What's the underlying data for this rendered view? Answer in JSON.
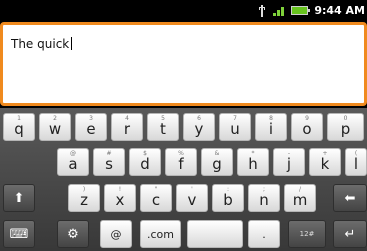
{
  "status_bar": {
    "time": "9:44 AM"
  },
  "text_field": {
    "value": "The quick"
  },
  "keyboard": {
    "row1": [
      {
        "label": "q",
        "sub": "1"
      },
      {
        "label": "w",
        "sub": "2"
      },
      {
        "label": "e",
        "sub": "3"
      },
      {
        "label": "r",
        "sub": "4"
      },
      {
        "label": "t",
        "sub": "5"
      },
      {
        "label": "y",
        "sub": "6"
      },
      {
        "label": "u",
        "sub": "7"
      },
      {
        "label": "i",
        "sub": "8"
      },
      {
        "label": "o",
        "sub": "9"
      },
      {
        "label": "p",
        "sub": "0"
      }
    ],
    "row2": [
      {
        "label": "a",
        "sub": "@"
      },
      {
        "label": "s",
        "sub": "#"
      },
      {
        "label": "d",
        "sub": "$"
      },
      {
        "label": "f",
        "sub": "%"
      },
      {
        "label": "g",
        "sub": "&"
      },
      {
        "label": "h",
        "sub": "*"
      },
      {
        "label": "j",
        "sub": "-"
      },
      {
        "label": "k",
        "sub": "+"
      },
      {
        "label": "l",
        "sub": "("
      }
    ],
    "row3": [
      {
        "label": "z",
        "sub": ")"
      },
      {
        "label": "x",
        "sub": "!"
      },
      {
        "label": "c",
        "sub": "\""
      },
      {
        "label": "v",
        "sub": "'"
      },
      {
        "label": "b",
        "sub": ":"
      },
      {
        "label": "n",
        "sub": ";"
      },
      {
        "label": "m",
        "sub": "/"
      }
    ],
    "shift_icon": "up-arrow-icon",
    "backspace_icon": "left-arrow-icon",
    "emoticon_icon": "keyboard-icon",
    "settings_icon": "gear-icon",
    "at_label": "@",
    "com_label": ".com",
    "period_label": ".",
    "symbols_label": "12#",
    "enter_icon": "enter-arrow-icon"
  }
}
